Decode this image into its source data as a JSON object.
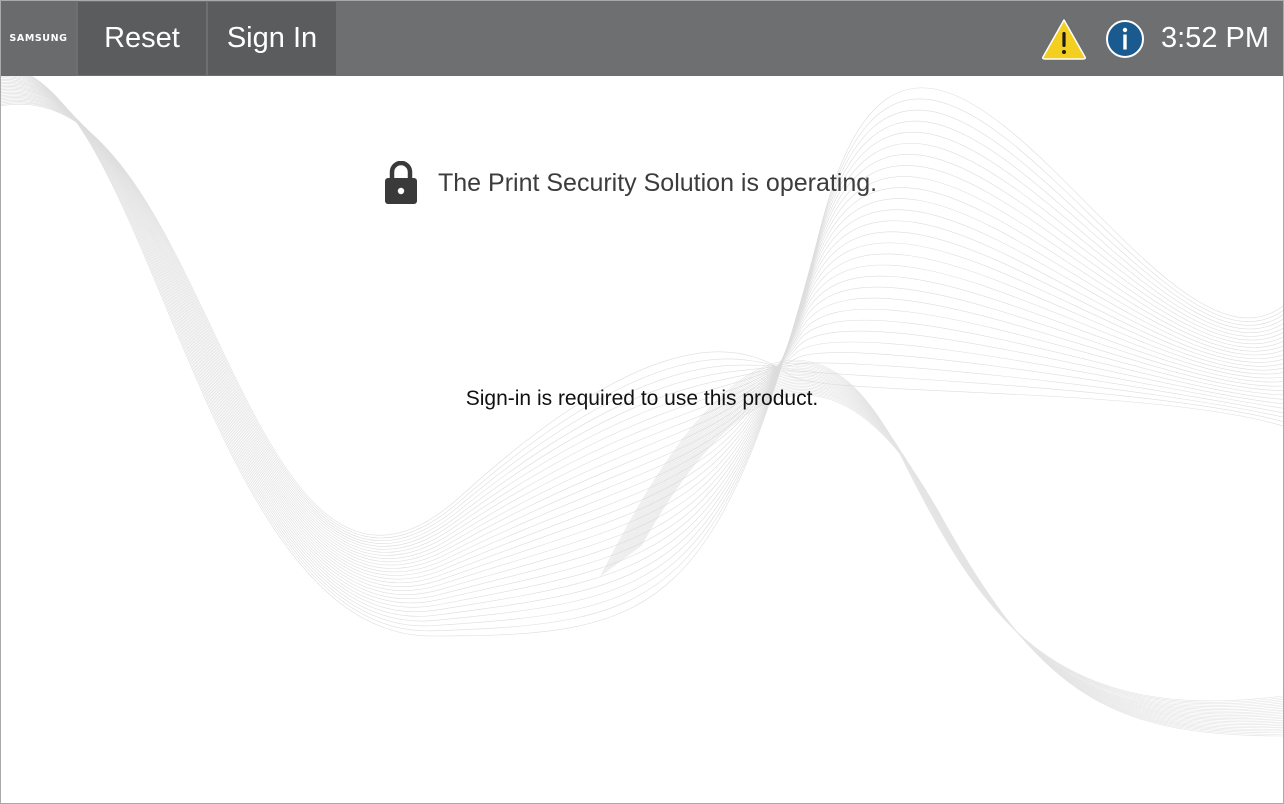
{
  "header": {
    "brand": "SAMSUNG",
    "reset_label": "Reset",
    "signin_label": "Sign In",
    "time": "3:52 PM",
    "icons": {
      "warning": "warning-triangle-icon",
      "info": "info-circle-icon"
    }
  },
  "main": {
    "security_message": "The Print Security Solution is operating.",
    "signin_message": "Sign-in is required to use this product.",
    "lock_icon": "lock-icon"
  },
  "colors": {
    "topbar": "#6e6f70",
    "button": "#5b5c5d",
    "warning": "#f3cf1f",
    "info": "#1a5a8e"
  }
}
